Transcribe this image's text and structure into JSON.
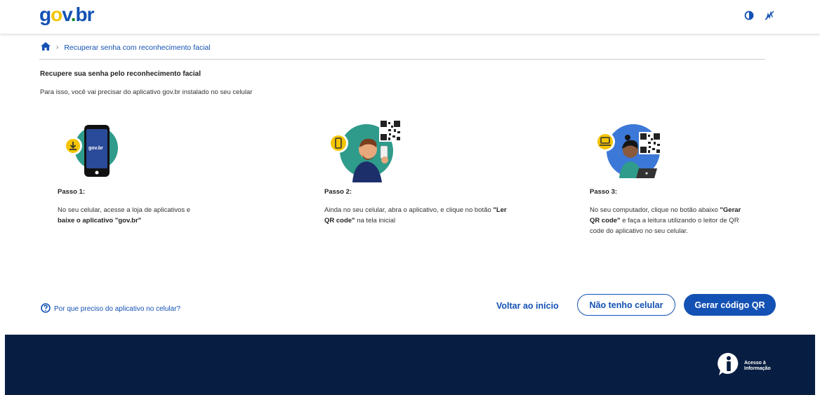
{
  "header": {
    "logo_g": "g",
    "logo_o": "o",
    "logo_v": "v",
    "logo_dot": ".",
    "logo_br": "br",
    "icons": [
      "contrast-icon",
      "vlibras-hand-icon"
    ]
  },
  "breadcrumb": {
    "home_icon": "home-icon",
    "current": "Recuperar senha com reconhecimento facial"
  },
  "main": {
    "title": "Recupere sua senha pelo reconhecimento facial",
    "subtitle": "Para isso, você vai precisar do aplicativo gov.br instalado no seu celular",
    "phone_logo": "gov.br",
    "steps": [
      {
        "label": "Passo 1:",
        "text1": "No seu celular, acesse a loja de aplicativos e ",
        "bold1": "baixe o aplicativo \"gov.br\"",
        "text2": ""
      },
      {
        "label": "Passo 2:",
        "text1": "Ainda no seu celular, abra o aplicativo, e clique no botão ",
        "bold1": "\"Ler QR code\"",
        "text2": " na tela inicial"
      },
      {
        "label": "Passo 3:",
        "text1": "No seu computador, clique no botão abaixo ",
        "bold1": "\"Gerar QR code\"",
        "text2": " e faça a leitura utilizando o leitor de QR code do aplicativo no seu celular."
      }
    ]
  },
  "actions": {
    "help_link": "Por que preciso do aplicativo no celular?",
    "back_link": "Voltar ao início",
    "no_phone_button": "Não tenho celular",
    "generate_button": "Gerar código QR"
  },
  "footer": {
    "access_line1": "Acesso à",
    "access_line2": "Informação"
  },
  "colors": {
    "primary": "#1351b4",
    "footer_bg": "#071d41",
    "teal": "#2f9b8b",
    "yellow": "#f4c500"
  }
}
